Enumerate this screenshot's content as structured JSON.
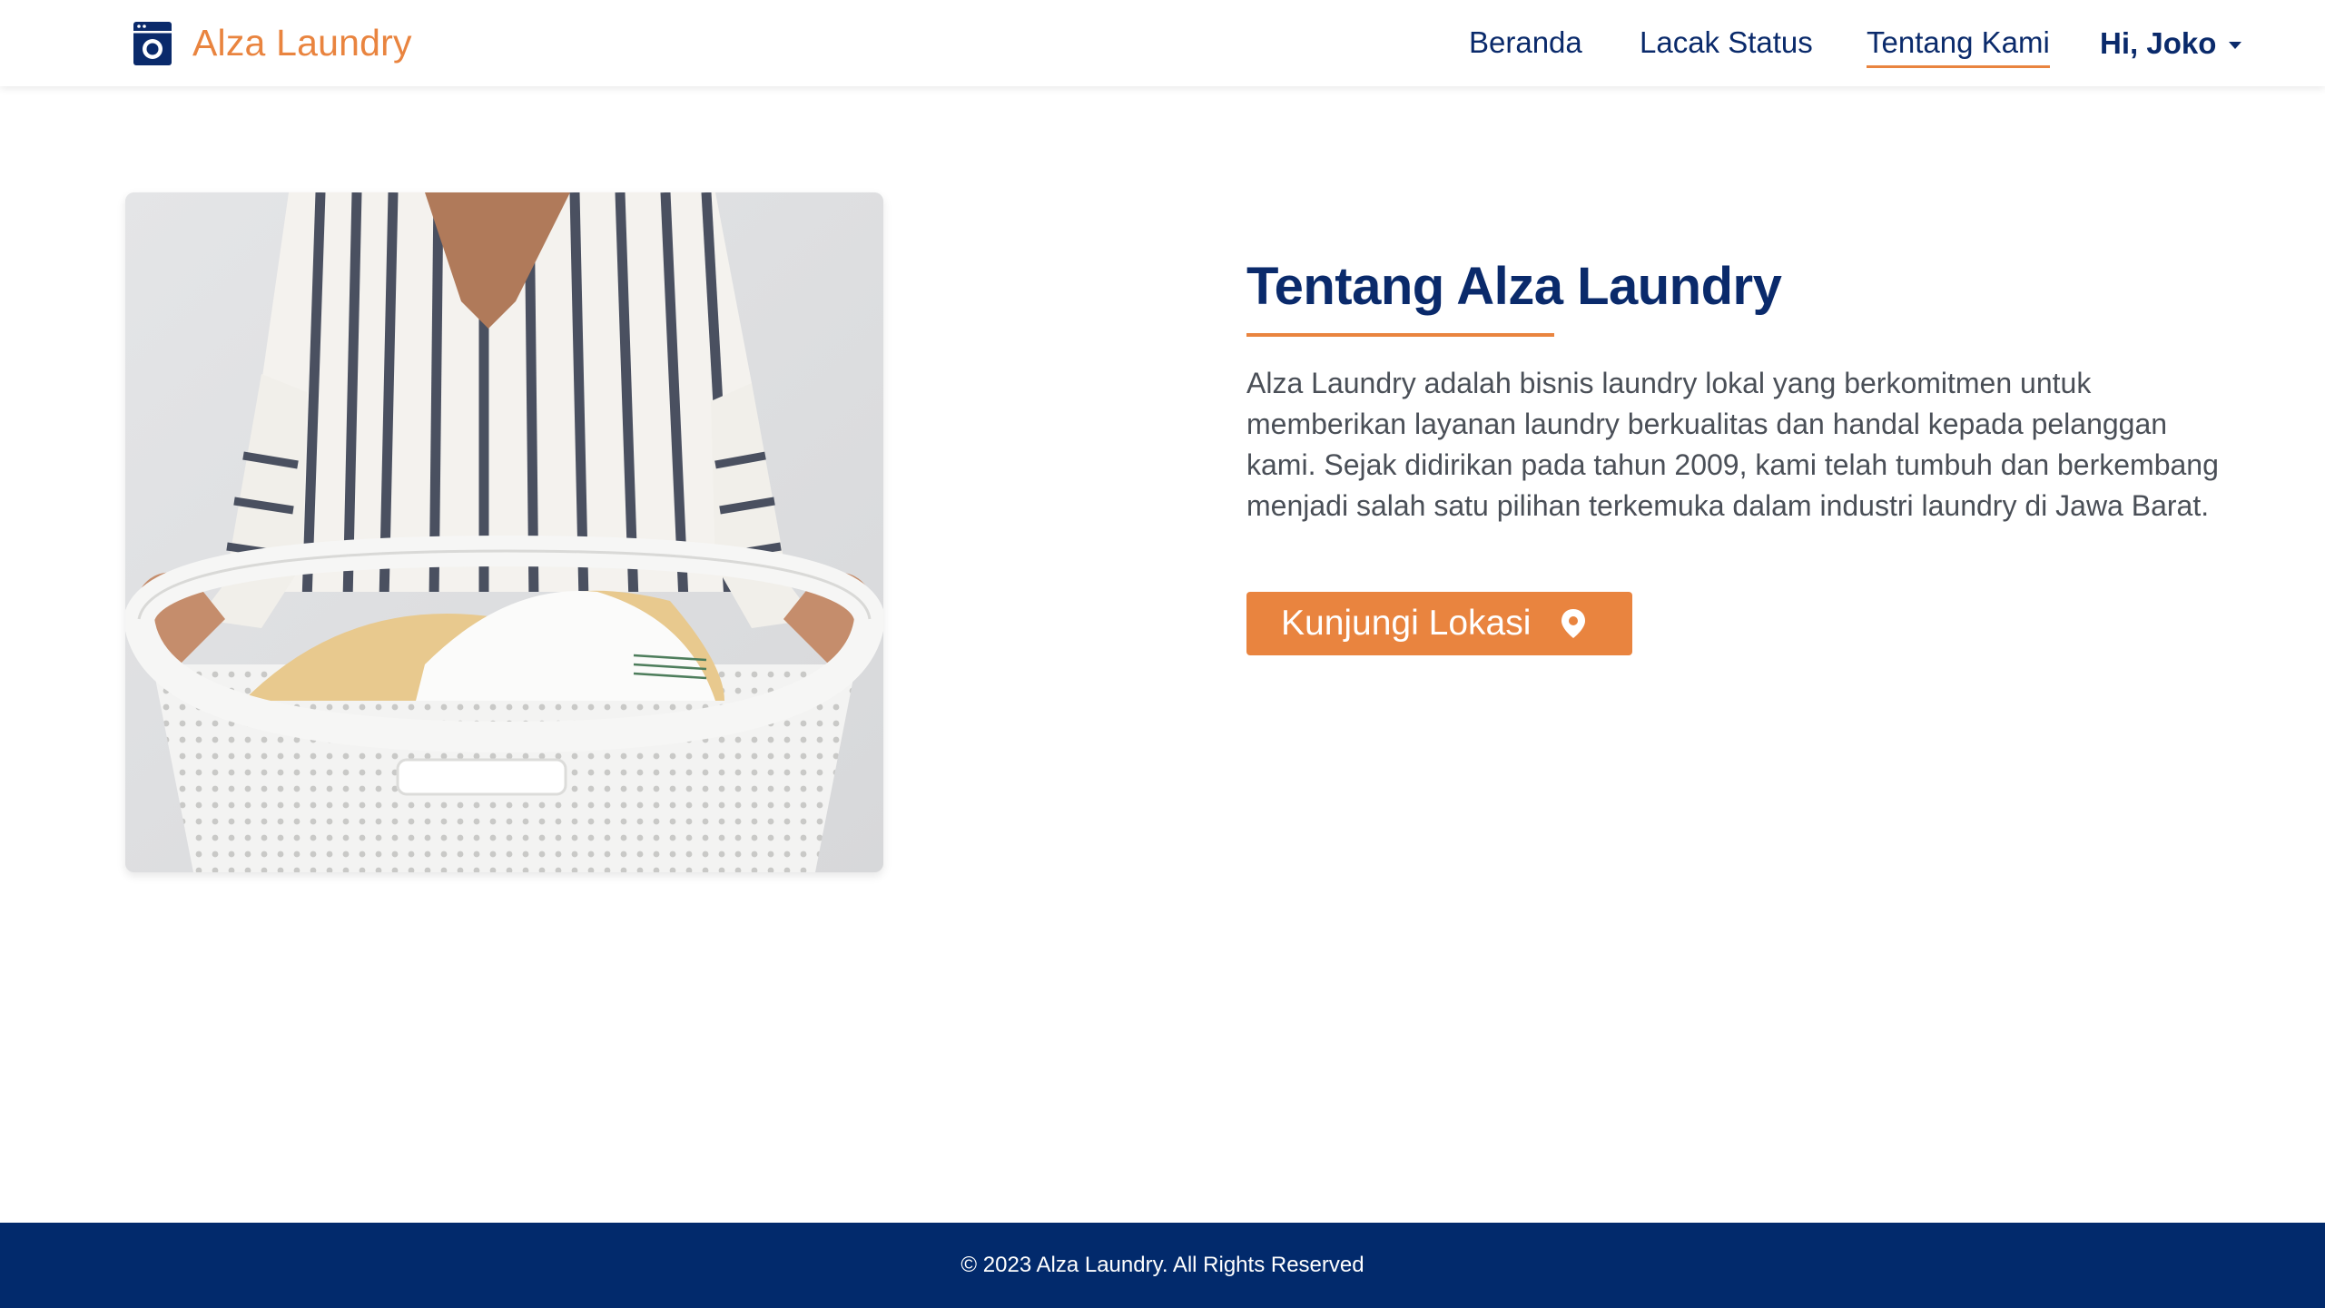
{
  "brand": {
    "name": "Alza Laundry",
    "icon": "washing-machine-icon",
    "color": "#e9843f"
  },
  "nav": {
    "items": [
      {
        "label": "Beranda",
        "active": false
      },
      {
        "label": "Lacak Status",
        "active": false
      },
      {
        "label": "Tentang Kami",
        "active": true
      }
    ],
    "user_greeting": "Hi, Joko",
    "user_menu_icon": "caret-down-icon"
  },
  "about": {
    "title": "Tentang Alza Laundry",
    "description": "Alza Laundry adalah bisnis laundry lokal yang berkomitmen untuk memberikan layanan laundry berkualitas dan handal kepada pelanggan kami. Sejak didirikan pada tahun 2009, kami telah tumbuh dan berkembang menjadi salah satu pilihan terkemuka dalam industri laundry di Jawa Barat.",
    "button_label": "Kunjungi Lokasi",
    "button_icon": "map-pin-icon"
  },
  "footer": {
    "text": "© 2023 Alza Laundry. All Rights Reserved"
  },
  "colors": {
    "primary": "#022a6c",
    "accent": "#e9843f",
    "text": "#4a4f57"
  }
}
